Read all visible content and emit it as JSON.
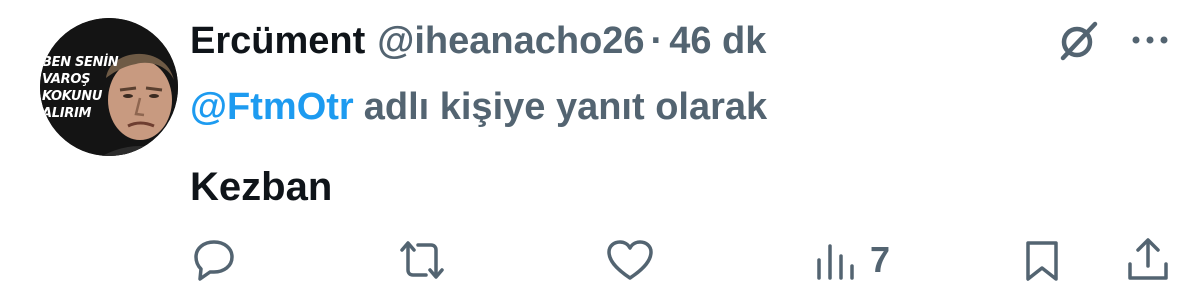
{
  "avatar": {
    "caption_lines": [
      "BEN SENİN",
      "VAROŞ",
      "KOKUNU",
      "ALIRIM"
    ]
  },
  "author": {
    "display_name": "Ercüment",
    "handle": "@iheanacho26",
    "separator": "·",
    "time": "46 dk"
  },
  "reply": {
    "mention": "@FtmOtr",
    "suffix": "adlı kişiye yanıt olarak"
  },
  "tweet": {
    "text": "Kezban"
  },
  "actions": {
    "views_count": "7"
  },
  "icons": {
    "top_right": [
      "grok-icon",
      "more-icon"
    ],
    "action_bar": [
      "reply-icon",
      "retweet-icon",
      "like-icon",
      "views-icon",
      "bookmark-icon",
      "share-icon"
    ]
  },
  "colors": {
    "text_primary": "#0f1419",
    "text_secondary": "#536471",
    "link": "#1d9bf0",
    "background": "#ffffff"
  }
}
